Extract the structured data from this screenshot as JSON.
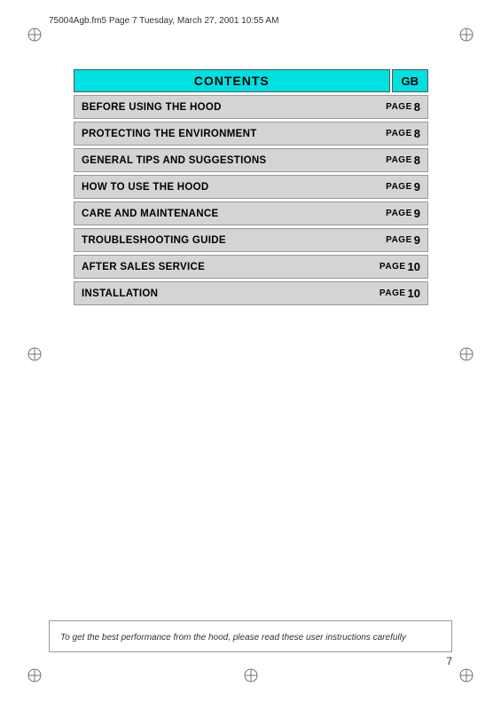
{
  "header": {
    "file_info": "75004Agb.fm5  Page 7  Tuesday, March 27, 2001  10:55 AM"
  },
  "contents_title": "CONTENTS",
  "gb_label": "GB",
  "toc_items": [
    {
      "title": "BEFORE USING THE HOOD",
      "page_label": "PAGE",
      "page_num": "8"
    },
    {
      "title": "PROTECTING THE ENVIRONMENT",
      "page_label": "PAGE",
      "page_num": "8"
    },
    {
      "title": "GENERAL TIPS AND SUGGESTIONS",
      "page_label": "PAGE",
      "page_num": "8"
    },
    {
      "title": "HOW TO USE THE HOOD",
      "page_label": "PAGE",
      "page_num": "9"
    },
    {
      "title": "CARE AND MAINTENANCE",
      "page_label": "PAGE",
      "page_num": "9"
    },
    {
      "title": "TROUBLESHOOTING GUIDE",
      "page_label": "PAGE",
      "page_num": "9"
    },
    {
      "title": "AFTER SALES SERVICE",
      "page_label": "PAGE",
      "page_num": "10"
    },
    {
      "title": "INSTALLATION",
      "page_label": "PAGE",
      "page_num": "10"
    }
  ],
  "bottom_note": "To get the best performance from the hood, please read these user instructions carefully",
  "page_number": "7",
  "colors": {
    "accent_cyan": "#00e0e0",
    "row_bg": "#d4d4d4",
    "border": "#999999"
  }
}
